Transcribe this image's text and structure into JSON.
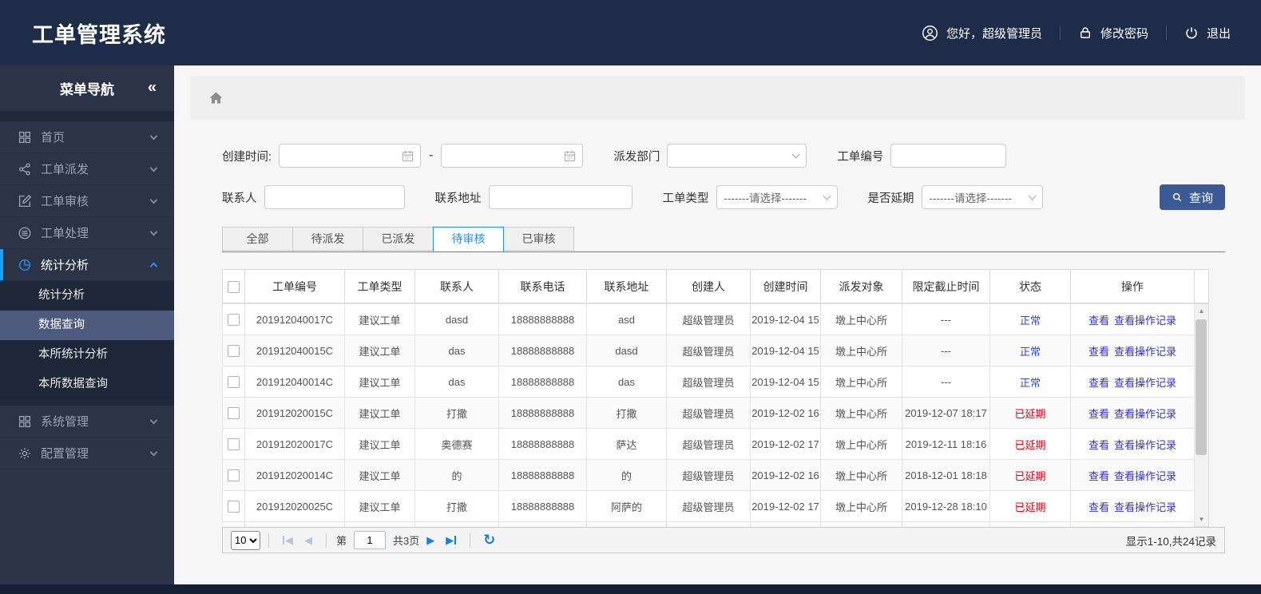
{
  "header": {
    "title": "工单管理系统",
    "greeting": "您好，超级管理员",
    "change_password": "修改密码",
    "logout": "退出"
  },
  "sidebar": {
    "title": "菜单导航",
    "items": [
      {
        "label": "首页",
        "icon": "grid-icon"
      },
      {
        "label": "工单派发",
        "icon": "share-icon"
      },
      {
        "label": "工单审核",
        "icon": "edit-icon"
      },
      {
        "label": "工单处理",
        "icon": "process-icon"
      },
      {
        "label": "统计分析",
        "icon": "pie-chart-icon",
        "active": true,
        "expanded": true,
        "children": [
          {
            "label": "统计分析"
          },
          {
            "label": "数据查询",
            "active": true
          },
          {
            "label": "本所统计分析"
          },
          {
            "label": "本所数据查询"
          }
        ]
      },
      {
        "label": "系统管理",
        "icon": "grid-icon"
      },
      {
        "label": "配置管理",
        "icon": "gear-icon"
      }
    ]
  },
  "filters": {
    "created_label": "创建时间:",
    "range_separator": "-",
    "dept_label": "派发部门",
    "order_no_label": "工单编号",
    "contact_label": "联系人",
    "address_label": "联系地址",
    "type_label": "工单类型",
    "delay_label": "是否延期",
    "select_placeholder": "-------请选择-------",
    "search_label": "查询",
    "created_start_value": "",
    "created_end_value": "",
    "order_no_value": "",
    "contact_value": "",
    "address_value": ""
  },
  "tabs": {
    "items": [
      {
        "label": "全部"
      },
      {
        "label": "待派发"
      },
      {
        "label": "已派发"
      },
      {
        "label": "待审核",
        "active": true
      },
      {
        "label": "已审核"
      }
    ]
  },
  "table": {
    "columns": [
      "工单编号",
      "工单类型",
      "联系人",
      "联系电话",
      "联系地址",
      "创建人",
      "创建时间",
      "派发对象",
      "限定截止时间",
      "状态",
      "操作"
    ],
    "view_label": "查看",
    "view_log_label": "查看操作记录",
    "rows": [
      {
        "order_no": "201912040017C",
        "type": "建议工单",
        "contact": "dasd",
        "phone": "18888888888",
        "address": "asd",
        "creator": "超级管理员",
        "created": "2019-12-04 15",
        "target": "墩上中心所",
        "deadline": "---",
        "status": "正常",
        "status_type": "normal"
      },
      {
        "order_no": "201912040015C",
        "type": "建议工单",
        "contact": "das",
        "phone": "18888888888",
        "address": "dasd",
        "creator": "超级管理员",
        "created": "2019-12-04 15",
        "target": "墩上中心所",
        "deadline": "---",
        "status": "正常",
        "status_type": "normal"
      },
      {
        "order_no": "201912040014C",
        "type": "建议工单",
        "contact": "das",
        "phone": "18888888888",
        "address": "das",
        "creator": "超级管理员",
        "created": "2019-12-04 15",
        "target": "墩上中心所",
        "deadline": "---",
        "status": "正常",
        "status_type": "normal"
      },
      {
        "order_no": "201912020015C",
        "type": "建议工单",
        "contact": "打撒",
        "phone": "18888888888",
        "address": "打撒",
        "creator": "超级管理员",
        "created": "2019-12-02 16",
        "target": "墩上中心所",
        "deadline": "2019-12-07 18:17",
        "status": "已延期",
        "status_type": "delayed"
      },
      {
        "order_no": "201912020017C",
        "type": "建议工单",
        "contact": "奥德赛",
        "phone": "18888888888",
        "address": "萨达",
        "creator": "超级管理员",
        "created": "2019-12-02 17",
        "target": "墩上中心所",
        "deadline": "2019-12-11 18:16",
        "status": "已延期",
        "status_type": "delayed"
      },
      {
        "order_no": "201912020014C",
        "type": "建议工单",
        "contact": "的",
        "phone": "18888888888",
        "address": "的",
        "creator": "超级管理员",
        "created": "2019-12-02 16",
        "target": "墩上中心所",
        "deadline": "2018-12-01 18:18",
        "status": "已延期",
        "status_type": "delayed"
      },
      {
        "order_no": "201912020025C",
        "type": "建议工单",
        "contact": "打撒",
        "phone": "18888888888",
        "address": "阿萨的",
        "creator": "超级管理员",
        "created": "2019-12-02 17",
        "target": "墩上中心所",
        "deadline": "2019-12-28 18:10",
        "status": "已延期",
        "status_type": "delayed"
      }
    ]
  },
  "pagination": {
    "page_size": "10",
    "page_prefix": "第",
    "page_value": "1",
    "page_total": "共3页",
    "summary": "显示1-10,共24记录"
  },
  "icons": {
    "collapse": "«",
    "nav_prev": "◀",
    "nav_next": "▶",
    "refresh": "↻",
    "scroll_up": "▲",
    "scroll_down": "▼"
  },
  "colors": {
    "accent_blue": "#2d8cf0",
    "link_blue": "#3333cc",
    "status_normal": "#2f49d1",
    "status_delayed": "#e60012",
    "search_button_blue": "#3c5a96",
    "header_bg": "#1e2c4a",
    "sidebar_bg": "#2a3446"
  }
}
